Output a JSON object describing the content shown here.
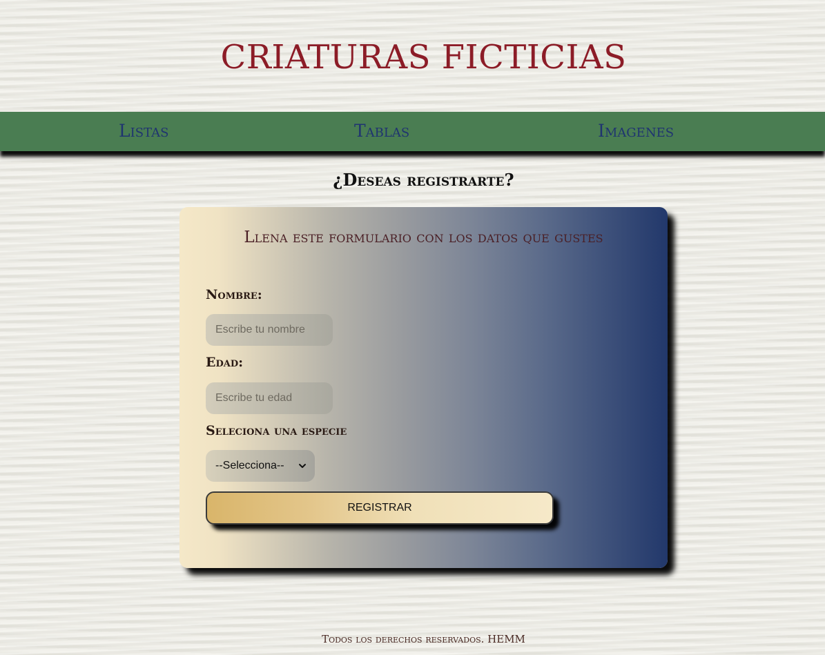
{
  "header": {
    "title": "CRIATURAS FICTICIAS"
  },
  "nav": {
    "items": [
      {
        "label": "Listas"
      },
      {
        "label": "Tablas"
      },
      {
        "label": "Imagenes"
      }
    ]
  },
  "main": {
    "heading": "¿Deseas registrarte?",
    "form": {
      "title": "Llena este formulario con los datos que gustes",
      "name_label": "Nombre:",
      "name_placeholder": "Escribe tu nombre",
      "age_label": "Edad:",
      "age_placeholder": "Escribe tu edad",
      "species_label": "Seleciona una especie",
      "species_selected": "--Selecciona--",
      "submit_label": "REGISTRAR"
    }
  },
  "footer": {
    "text": "Todos los derechos reservados. HEMM"
  },
  "colors": {
    "title": "#8c1c27",
    "nav_background": "#4a7d52",
    "nav_link": "#1f3470",
    "card_gradient_start": "#f5e8c8",
    "card_gradient_end": "#22386b"
  },
  "icons": {
    "select_arrow": "chevron-down-icon"
  }
}
